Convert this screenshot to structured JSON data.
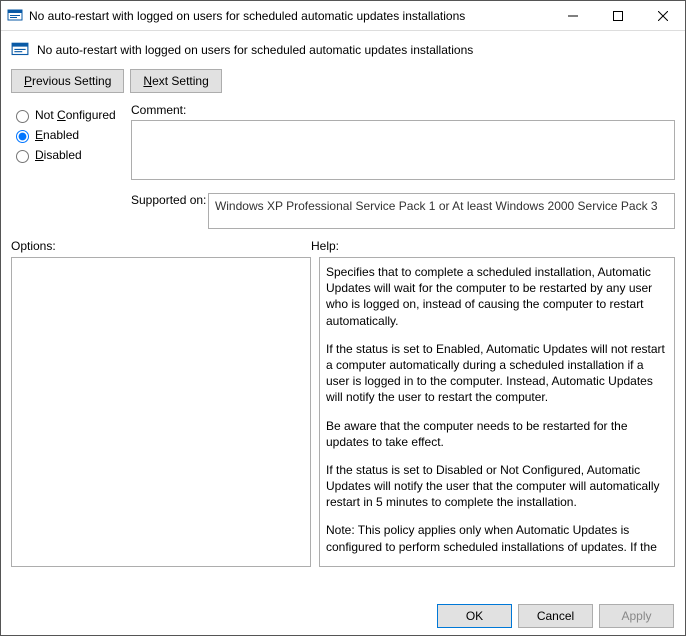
{
  "window": {
    "title": "No auto-restart with logged on users for scheduled automatic updates installations"
  },
  "header": {
    "policy_title": "No auto-restart with logged on users for scheduled automatic updates installations"
  },
  "nav": {
    "prev": "Previous Setting",
    "next": "Next Setting"
  },
  "state": {
    "not_configured": "Not Configured",
    "enabled": "Enabled",
    "disabled": "Disabled",
    "selected": "enabled"
  },
  "labels": {
    "comment": "Comment:",
    "supported_on": "Supported on:",
    "options": "Options:",
    "help": "Help:"
  },
  "comment_value": "",
  "supported_on_value": "Windows XP Professional Service Pack 1 or At least Windows 2000 Service Pack 3",
  "buttons": {
    "ok": "OK",
    "cancel": "Cancel",
    "apply": "Apply"
  },
  "help": {
    "p1": "Specifies that to complete a scheduled installation, Automatic Updates will wait for the computer to be restarted by any user who is logged on, instead of causing the computer to restart automatically.",
    "p2": "If the status is set to Enabled, Automatic Updates will not restart a computer automatically during a scheduled installation if a user is logged in to the computer. Instead, Automatic Updates will notify the user to restart the computer.",
    "p3": "Be aware that the computer needs to be restarted for the updates to take effect.",
    "p4": "If the status is set to Disabled or Not Configured, Automatic Updates will notify the user that the computer will automatically restart in 5 minutes to complete the installation.",
    "p5": "Note: This policy applies only when Automatic Updates is configured to perform scheduled installations of updates. If the"
  }
}
